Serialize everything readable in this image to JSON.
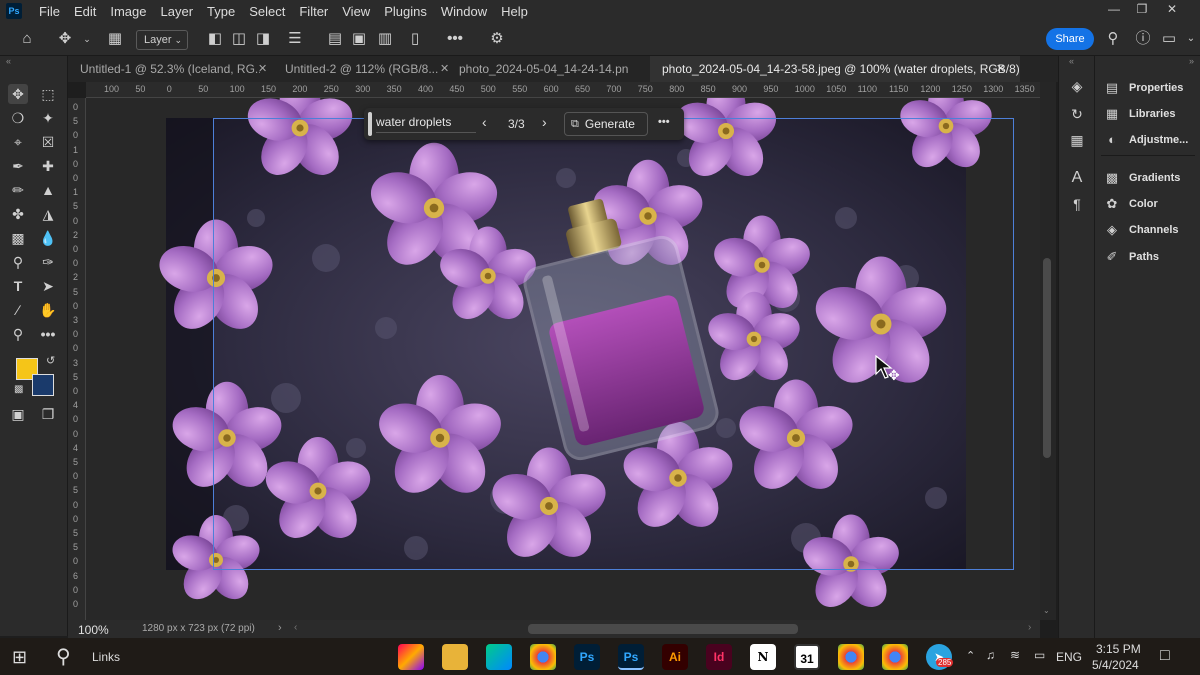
{
  "menu": [
    "File",
    "Edit",
    "Image",
    "Layer",
    "Type",
    "Select",
    "Filter",
    "View",
    "Plugins",
    "Window",
    "Help"
  ],
  "app_logo": "Ps",
  "options": {
    "layer_dropdown": "Layer",
    "share_label": "Share"
  },
  "tabs": [
    {
      "label": "Untitled-1 @ 52.3% (Iceland, RG...",
      "active": false
    },
    {
      "label": "Untitled-2 @ 112% (RGB/8...",
      "active": false
    },
    {
      "label": "photo_2024-05-04_14-24-14.png",
      "active": false
    },
    {
      "label": "photo_2024-05-04_14-23-58.jpeg @ 100% (water droplets, RGB/8) *",
      "active": true
    }
  ],
  "ruler_h": [
    "100",
    "50",
    "0",
    "50",
    "100",
    "150",
    "200",
    "250",
    "300",
    "350",
    "400",
    "450",
    "500",
    "550",
    "600",
    "650",
    "700",
    "750",
    "800",
    "850",
    "900",
    "950",
    "1000",
    "1050",
    "1100",
    "1150",
    "1200",
    "1250",
    "1300",
    "1350"
  ],
  "ruler_v": [
    "0",
    "5",
    "0",
    "1",
    "0",
    "0",
    "1",
    "5",
    "0",
    "2",
    "0",
    "0",
    "2",
    "5",
    "0",
    "3",
    "0",
    "0",
    "3",
    "5",
    "0",
    "4",
    "0",
    "0",
    "4",
    "5",
    "0",
    "5",
    "0",
    "0",
    "5",
    "5",
    "0",
    "6",
    "0",
    "0"
  ],
  "context_bar": {
    "prompt": "water droplets",
    "variation": "3/3",
    "generate_label": "Generate"
  },
  "status": {
    "zoom": "100%",
    "doc_size": "1280 px x 723 px (72 ppi)"
  },
  "colors": {
    "foreground": "#f5c518",
    "background": "#1a3a6b",
    "accent": "#1473e6"
  },
  "panels": [
    "Properties",
    "Libraries",
    "Adjustme...",
    "Gradients",
    "Color",
    "Channels",
    "Paths"
  ],
  "taskbar": {
    "search_label": "Links",
    "language": "ENG",
    "time": "3:15 PM",
    "date": "5/4/2024",
    "badge": "285",
    "calendar_day": "31",
    "apps": [
      "Ps",
      "Ps",
      "Ai",
      "Id",
      "N"
    ]
  }
}
